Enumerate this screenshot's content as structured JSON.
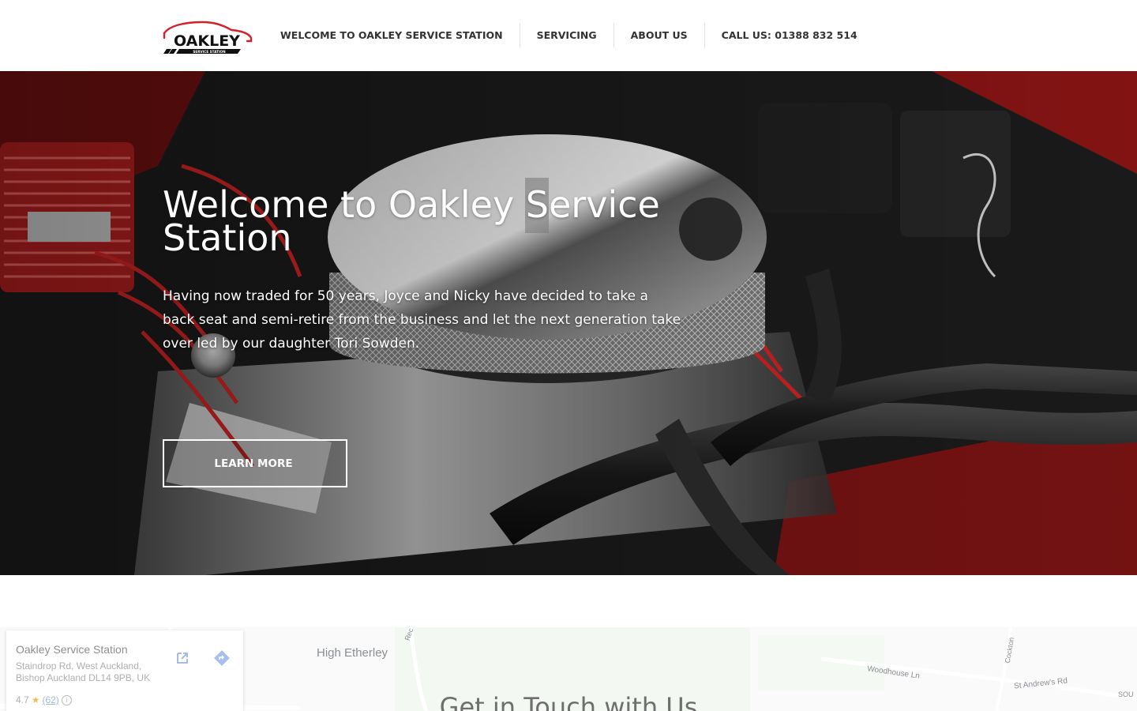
{
  "brand": {
    "logo_text": "OAKLEY",
    "logo_subtext": "SERVICE STATION",
    "logo_accent": "#d4202a"
  },
  "nav": {
    "items": [
      {
        "label": "WELCOME TO OAKLEY SERVICE STATION"
      },
      {
        "label": "SERVICING"
      },
      {
        "label": "ABOUT US"
      },
      {
        "label": "CALL US: 01388 832 514"
      }
    ]
  },
  "hero": {
    "title": "Welcome to Oakley Service Station",
    "text": "Having now traded for 50 years, Joyce and Nicky have decided to take a back seat and semi-retire from the business and let the next generation take over led by our daughter Tori Sowden.",
    "button_label": "LEARN MORE"
  },
  "map": {
    "labels": {
      "high_etherley": "High Etherley",
      "woodhouse_ln": "Woodhouse Ln",
      "st_andrews_rd": "St Andrew's Rd",
      "cockton": "Cockton",
      "rec": "Rec",
      "sou": "SOU"
    },
    "card": {
      "name": "Oakley Service Station",
      "address_line1": "Staindrop Rd, West Auckland,",
      "address_line2": "Bishop Auckland DL14 9PB, UK",
      "rating": "4.7",
      "reviews": "(62)"
    }
  },
  "contact": {
    "title": "Get in Touch with Us"
  }
}
